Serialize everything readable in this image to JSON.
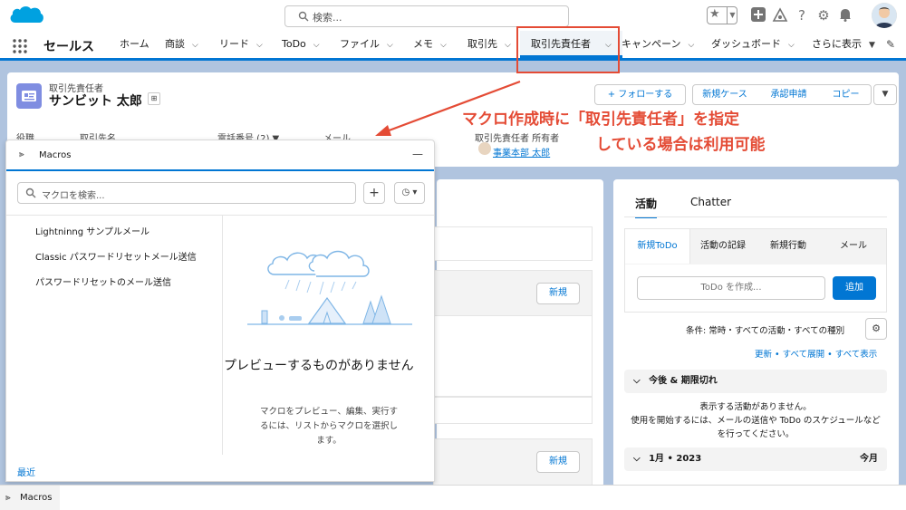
{
  "colors": {
    "brand": "#0176d3",
    "annotation": "#e44b35",
    "icon_contact": "#7f8de1"
  },
  "global_header": {
    "search_placeholder": "検索..."
  },
  "nav": {
    "app_name": "セールス",
    "items": [
      {
        "label": "ホーム",
        "has_menu": false
      },
      {
        "label": "商談",
        "has_menu": true
      },
      {
        "label": "リード",
        "has_menu": true
      },
      {
        "label": "ToDo",
        "has_menu": true
      },
      {
        "label": "ファイル",
        "has_menu": true
      },
      {
        "label": "メモ",
        "has_menu": true
      },
      {
        "label": "取引先",
        "has_menu": true
      },
      {
        "label": "取引先責任者",
        "has_menu": true,
        "active": true
      },
      {
        "label": "キャンペーン",
        "has_menu": true
      },
      {
        "label": "ダッシュボード",
        "has_menu": true
      },
      {
        "label": "さらに表示",
        "has_menu": true
      }
    ]
  },
  "record": {
    "object_type": "取引先責任者",
    "name": "サンビット 太郎",
    "buttons": {
      "follow": "+ フォローする",
      "new_case": "新規ケース",
      "approval": "承認申請",
      "copy": "コピー"
    },
    "fields": {
      "title_label": "役職",
      "account_label": "取引先名",
      "phone_label": "電話番号 (2) ▼",
      "email_label": "メール",
      "owner_label": "取引先責任者 所有者",
      "owner_value": "事業本部 太郎"
    }
  },
  "annotation": {
    "line1": "マクロ作成時に「取引先責任者」を指定",
    "line2": "している場合は利用可能"
  },
  "main_card": {
    "new_label_1": "新規",
    "new_label_2": "新規"
  },
  "activity": {
    "tabs": [
      "活動",
      "Chatter"
    ],
    "sub_tabs": [
      "新規ToDo",
      "活動の記録",
      "新規行動",
      "メール"
    ],
    "todo_placeholder": "ToDo を作成...",
    "add_label": "追加",
    "filter": "条件: 常時・すべての活動・すべての種別",
    "links": "更新 • すべて展開 • すべて表示",
    "upcoming": "今後 & 期限切れ",
    "empty_line1": "表示する活動がありません。",
    "empty_line2": "使用を開始するには、メールの送信や ToDo のスケジュールなどを行ってください。",
    "month": "1月 • 2023",
    "this_month": "今月"
  },
  "macros": {
    "title": "Macros",
    "search_placeholder": "マクロを検索...",
    "items": [
      "Lightninng サンプルメール",
      "Classic パスワードリセットメール送信",
      "パスワードリセットのメール送信"
    ],
    "preview_title": "プレビューするものがありません",
    "preview_desc": "マクロをプレビュー、編集、実行するには、リストからマクロを選択します。",
    "recent": "最近"
  },
  "utility_bar": {
    "macros_label": "Macros"
  }
}
